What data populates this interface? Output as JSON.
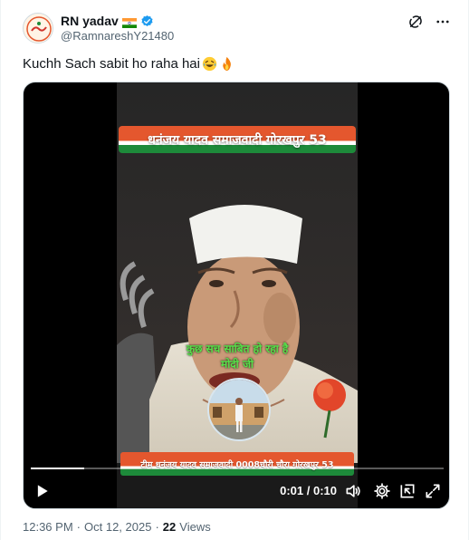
{
  "user": {
    "display_name": "RN yadav",
    "handle": "@RamnareshY21480",
    "flag_icon": "india-flag-icon",
    "verified_icon": "verified-badge-icon"
  },
  "tweet": {
    "text": "Kuchh Sach sabit ho raha hai",
    "emojis": [
      "laughing-tears-emoji",
      "fire-emoji"
    ]
  },
  "video": {
    "banner_top": "धनंजय यादव समाजवादी गोरखपुर 53",
    "overlay_line_1": "कुछ सच साबित हो रहा है",
    "overlay_line_2": "मोदी जी",
    "banner_bottom": "टीम धनंजय यादव समाजवादी 0008चौरी चौरा गोरखपुर 53",
    "time_display": "0:01 / 0:10",
    "progress_fraction": 0.13
  },
  "meta": {
    "time": "12:36 PM",
    "separator": "·",
    "date": "Oct 12, 2025",
    "views_count": "22",
    "views_label": "Views"
  },
  "colors": {
    "accent": "#1d9bf0",
    "saffron": "#e4572e",
    "green": "#1d8a3a",
    "overlay_green": "#58e04a"
  }
}
